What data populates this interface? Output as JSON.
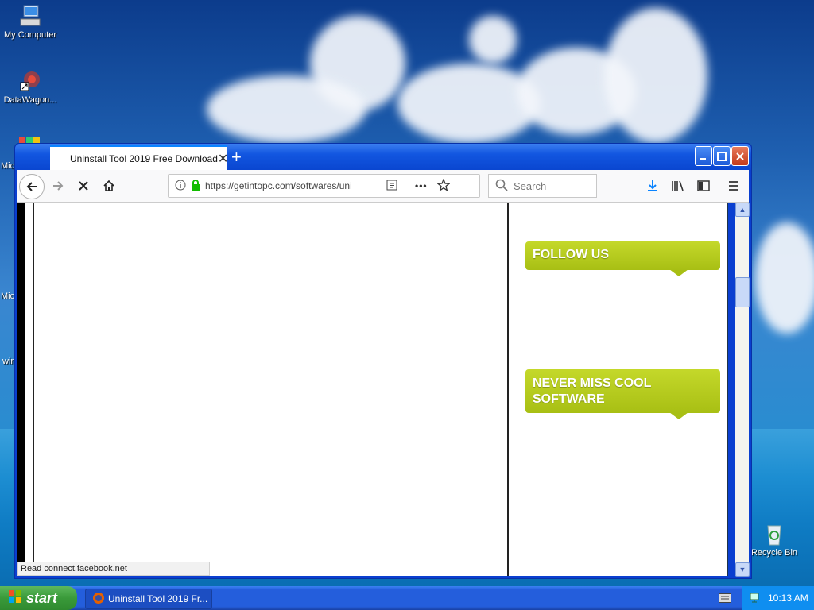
{
  "desktop": {
    "icons": [
      {
        "label": "My Computer",
        "icon": "computer-icon"
      },
      {
        "label": "DataWagon...",
        "icon": "shortcut-icon"
      },
      {
        "label": "Recycle Bin",
        "icon": "recycle-bin-icon"
      }
    ],
    "cut_labels": [
      "Mic",
      "Mic",
      "wir"
    ]
  },
  "browser": {
    "tab_title": "Uninstall Tool 2019 Free Download",
    "new_tab_icon": "plus-icon",
    "url": "https://getintopc.com/softwares/uni",
    "search_placeholder": "Search",
    "page_actions_icon": "more-icon",
    "status_text": "Read connect.facebook.net",
    "sidebar_widgets": [
      {
        "label": "FOLLOW US"
      },
      {
        "label_line1": "NEVER MISS COOL",
        "label_line2": "SOFTWARE"
      }
    ],
    "colors": {
      "accent": "#0a84ff",
      "widget_green": "#b6cc1e",
      "titlebar": "#0a46d0"
    }
  },
  "taskbar": {
    "start_label": "start",
    "task_label": "Uninstall Tool 2019 Fr...",
    "clock": "10:13 AM"
  }
}
